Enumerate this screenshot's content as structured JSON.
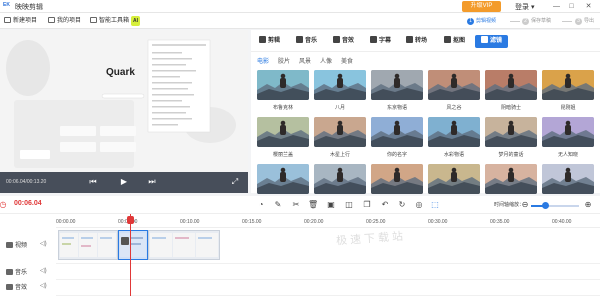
{
  "app": {
    "logo": "EK",
    "title": "映映剪辑"
  },
  "titlebar": {
    "vip_label": "升级VIP",
    "login_label": "登录",
    "minimize": "—",
    "maximize": "□",
    "close": "✕"
  },
  "toolbar": {
    "new_project": "新建项目",
    "my_projects": "我的项目",
    "smart_tools": "智能工具箱",
    "ai_badge": "AI"
  },
  "steps": [
    {
      "num": "1",
      "label": "剪辑视频"
    },
    {
      "num": "2",
      "label": "保存草稿"
    },
    {
      "num": "3",
      "label": "导出"
    }
  ],
  "preview": {
    "brand_text": "Quark",
    "timecode": "00:06.04/00:13.20",
    "ctl_prev": "⏮",
    "ctl_play": "▶",
    "ctl_next": "⏭",
    "ctl_fullscreen": "⤢"
  },
  "tabs": [
    {
      "label": "剪辑"
    },
    {
      "label": "音乐"
    },
    {
      "label": "音效"
    },
    {
      "label": "字幕"
    },
    {
      "label": "转场"
    },
    {
      "label": "抠图"
    },
    {
      "label": "滤镜"
    }
  ],
  "subtabs": [
    "电影",
    "胶片",
    "风景",
    "人像",
    "美食"
  ],
  "filters": [
    {
      "label": "布鲁克林",
      "tint": "#7fb8c9"
    },
    {
      "label": "八月",
      "tint": "#89c4de"
    },
    {
      "label": "东京物语",
      "tint": "#a0a8b0"
    },
    {
      "label": "风之谷",
      "tint": "#c08e78"
    },
    {
      "label": "阴暗骑士",
      "tint": "#b87d68"
    },
    {
      "label": "昆刚姐",
      "tint": "#d9a24a"
    },
    {
      "label": "樱丽兰盖",
      "tint": "#b5bfa0"
    },
    {
      "label": "木星上行",
      "tint": "#c9a78f"
    },
    {
      "label": "你的名字",
      "tint": "#8faed6"
    },
    {
      "label": "水彩物语",
      "tint": "#7fb0d0"
    },
    {
      "label": "梦月的童话",
      "tint": "#c7b39c"
    },
    {
      "label": "无人知晓",
      "tint": "#b3a6d6"
    },
    {
      "label": "",
      "tint": "#9ac0d9"
    },
    {
      "label": "",
      "tint": "#a8b6c2"
    },
    {
      "label": "",
      "tint": "#d1a687"
    },
    {
      "label": "",
      "tint": "#c9b78e"
    },
    {
      "label": "",
      "tint": "#d7b3a0"
    },
    {
      "label": "",
      "tint": "#bfc6d8"
    }
  ],
  "timeline": {
    "current_time": "00:06.04",
    "zoom_label": "时间轴缩放：",
    "zoom_level": 0.3,
    "ruler_ticks": [
      "00:00.00",
      "00:05.00",
      "00:10.00",
      "00:15.00",
      "00:20.00",
      "00:25.00",
      "00:30.00",
      "00:35.00",
      "00:40.00"
    ],
    "tracks": [
      {
        "label": "视频"
      },
      {
        "label": "音乐"
      },
      {
        "label": "音效"
      }
    ],
    "watermark": "极速下载站"
  }
}
